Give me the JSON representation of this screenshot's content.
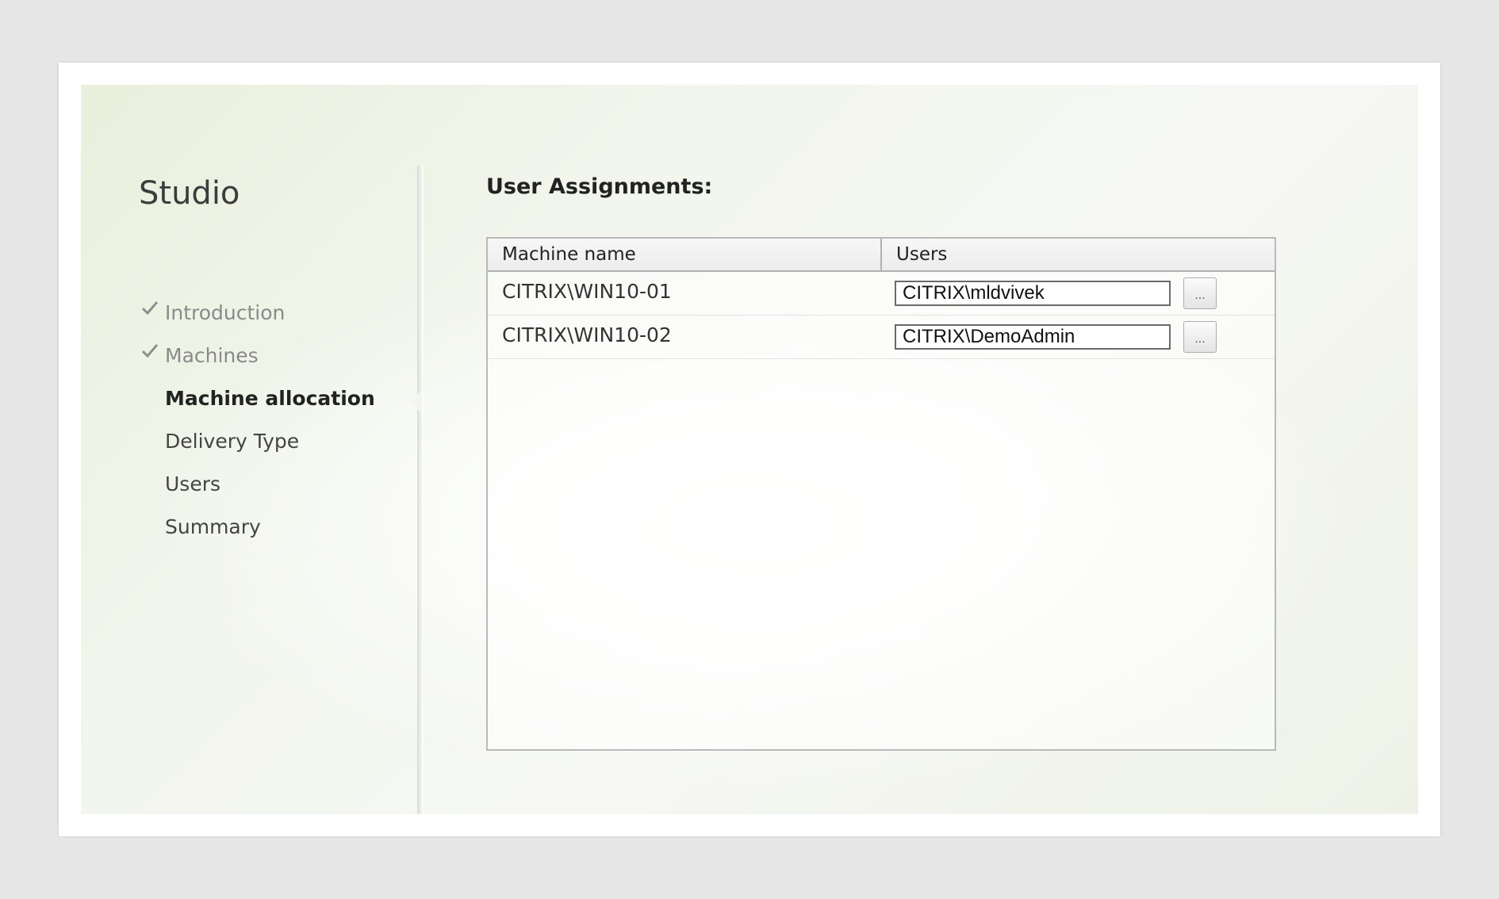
{
  "app": {
    "title": "Studio"
  },
  "nav": {
    "items": [
      {
        "label": "Introduction",
        "state": "done"
      },
      {
        "label": "Machines",
        "state": "done"
      },
      {
        "label": "Machine allocation",
        "state": "current"
      },
      {
        "label": "Delivery Type",
        "state": "pending"
      },
      {
        "label": "Users",
        "state": "pending"
      },
      {
        "label": "Summary",
        "state": "pending"
      }
    ]
  },
  "main": {
    "section_title": "User Assignments:",
    "table": {
      "columns": [
        "Machine name",
        "Users"
      ],
      "rows": [
        {
          "machine": "CITRIX\\WIN10-01",
          "user": "CITRIX\\mldvivek",
          "browse_label": "..."
        },
        {
          "machine": "CITRIX\\WIN10-02",
          "user": "CITRIX\\DemoAdmin",
          "browse_label": "..."
        }
      ]
    }
  },
  "colors": {
    "check": "#8f8f8f",
    "accent_bg": "#e9f0dd"
  },
  "icons": {
    "done_marker": "check-icon"
  }
}
